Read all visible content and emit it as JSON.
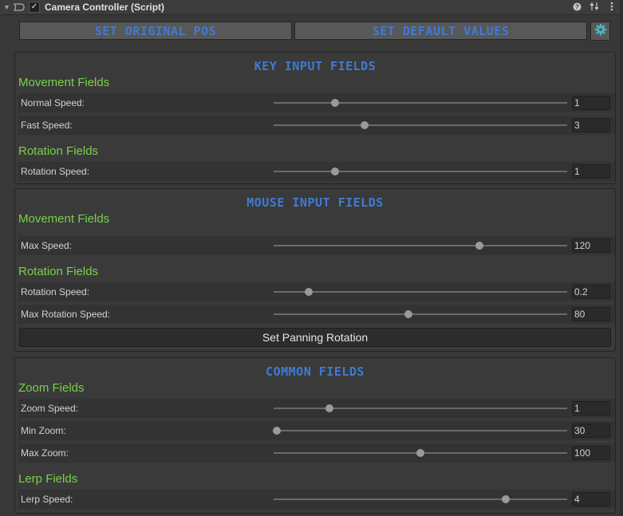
{
  "header": {
    "title": "Camera Controller (Script)",
    "checked": true
  },
  "top_buttons": {
    "set_original_pos": "SET ORIGINAL POS",
    "set_default_values": "SET DEFAULT VALUES"
  },
  "key_input": {
    "title": "KEY INPUT FIELDS",
    "movement_heading": "Movement Fields",
    "normal_speed": {
      "label": "Normal Speed:",
      "value": "1",
      "fraction": 0.21
    },
    "fast_speed": {
      "label": "Fast Speed:",
      "value": "3",
      "fraction": 0.31
    },
    "rotation_heading": "Rotation Fields",
    "rotation_speed": {
      "label": "Rotation Speed:",
      "value": "1",
      "fraction": 0.21
    }
  },
  "mouse_input": {
    "title": "MOUSE INPUT FIELDS",
    "movement_heading": "Movement Fields",
    "max_speed": {
      "label": "Max Speed:",
      "value": "120",
      "fraction": 0.7
    },
    "rotation_heading": "Rotation Fields",
    "rotation_speed": {
      "label": "Rotation Speed:",
      "value": "0.2",
      "fraction": 0.12
    },
    "max_rotation_speed": {
      "label": "Max Rotation Speed:",
      "value": "80",
      "fraction": 0.46
    },
    "set_panning_rotation": "Set Panning Rotation"
  },
  "common": {
    "title": "COMMON FIELDS",
    "zoom_heading": "Zoom Fields",
    "zoom_speed": {
      "label": "Zoom Speed:",
      "value": "1",
      "fraction": 0.19
    },
    "min_zoom": {
      "label": "Min Zoom:",
      "value": "30",
      "fraction": 0.01
    },
    "max_zoom": {
      "label": "Max Zoom:",
      "value": "100",
      "fraction": 0.5
    },
    "lerp_heading": "Lerp Fields",
    "lerp_speed": {
      "label": "Lerp Speed:",
      "value": "4",
      "fraction": 0.79
    }
  }
}
